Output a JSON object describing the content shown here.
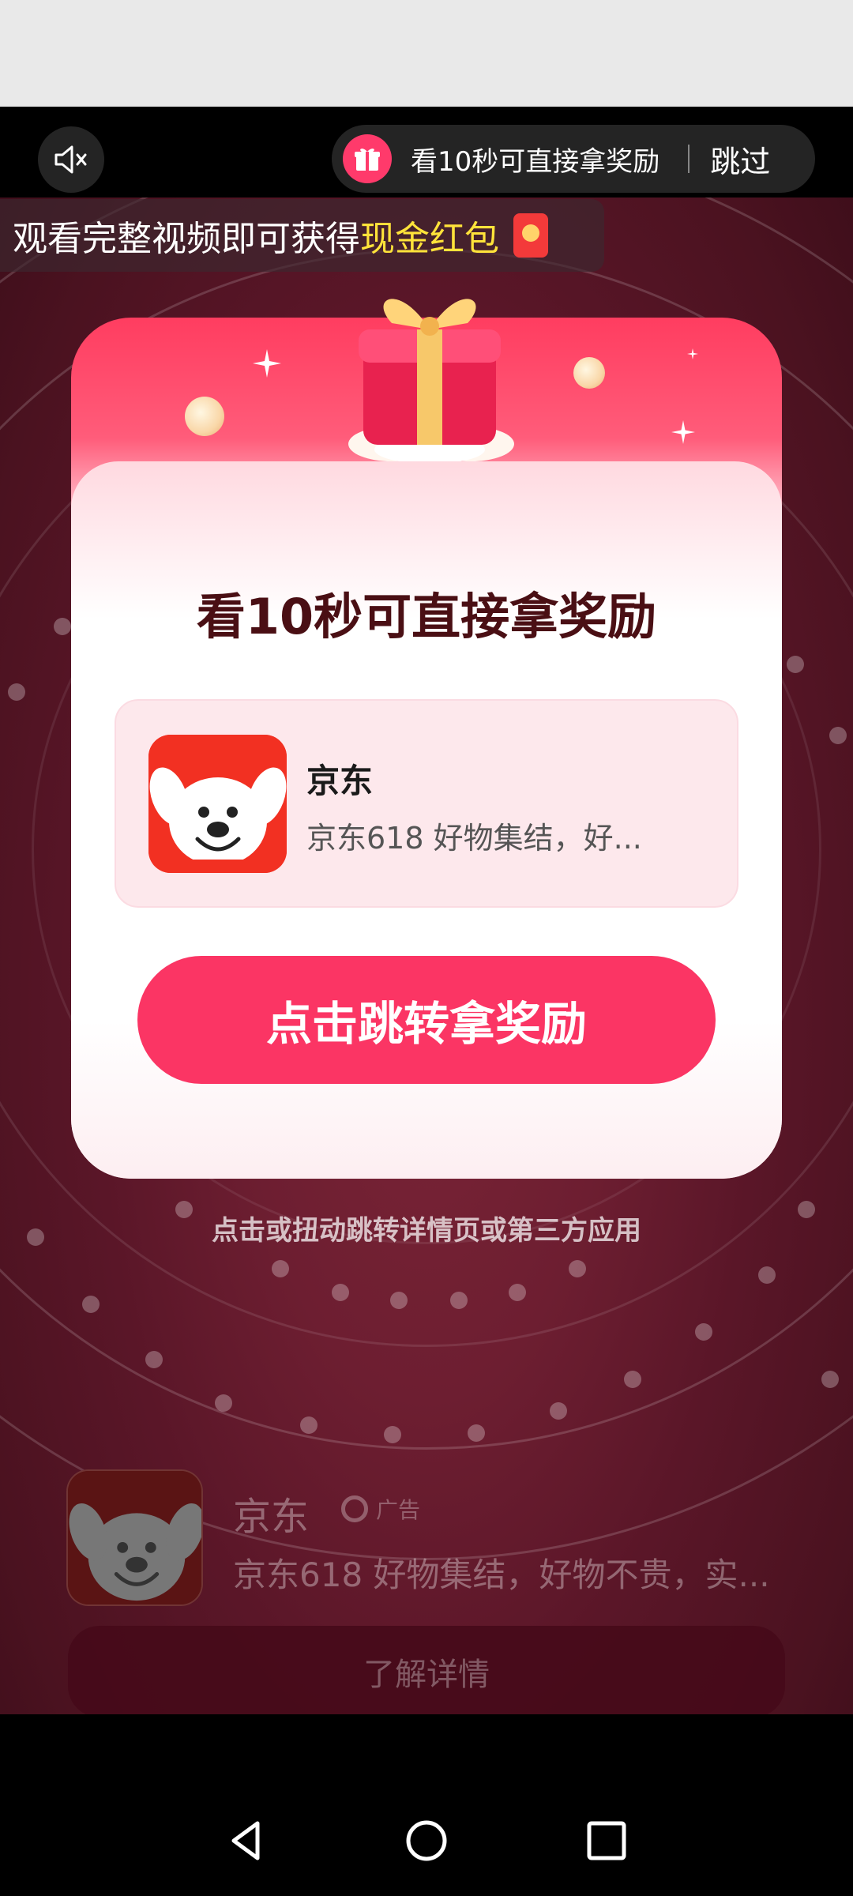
{
  "top_bar": {
    "mute_icon": "speaker-muted-icon",
    "reward_icon": "gift-icon",
    "reward_text": "看10秒可直接拿奖励",
    "skip_label": "跳过"
  },
  "banner": {
    "text_prefix": "观看完整视频即可获得",
    "text_highlight": "现金红包",
    "icon": "red-packet-icon",
    "highlight_color": "#ffe33a"
  },
  "reward_card": {
    "title": "看10秒可直接拿奖励",
    "app": {
      "name": "京东",
      "description": "京东618 好物集结，好...",
      "icon": "jd-dog-logo"
    },
    "cta_label": "点击跳转拿奖励",
    "cta_color": "#fb3564"
  },
  "hint": "点击或扭动跳转详情页或第三方应用",
  "ad_footer": {
    "name": "京东",
    "badge": "广告",
    "description": "京东618 好物集结，好物不贵，实...",
    "learn_more_label": "了解详情"
  },
  "nav": {
    "back_icon": "triangle-back-icon",
    "home_icon": "circle-home-icon",
    "recent_icon": "square-recent-icon"
  }
}
